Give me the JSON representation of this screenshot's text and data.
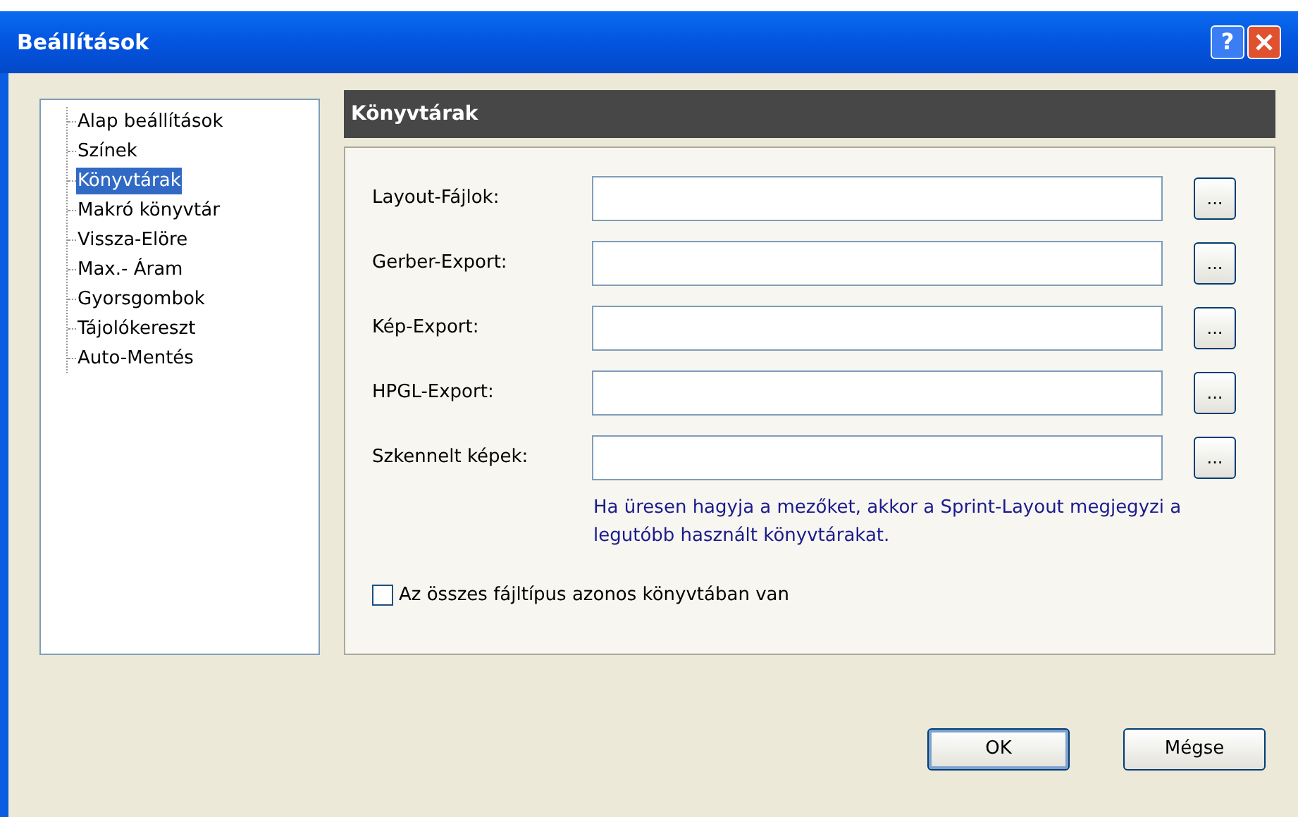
{
  "window": {
    "title": "Beállítások",
    "help_button": "?"
  },
  "sidebar": {
    "items": [
      {
        "label": "Alap beállítások",
        "selected": false
      },
      {
        "label": "Színek",
        "selected": false
      },
      {
        "label": "Könyvtárak",
        "selected": true
      },
      {
        "label": "Makró könyvtár",
        "selected": false
      },
      {
        "label": "Vissza-Elöre",
        "selected": false
      },
      {
        "label": "Max.- Áram",
        "selected": false
      },
      {
        "label": "Gyorsgombok",
        "selected": false
      },
      {
        "label": "Tájolókereszt",
        "selected": false
      },
      {
        "label": "Auto-Mentés",
        "selected": false
      }
    ]
  },
  "panel": {
    "title": "Könyvtárak",
    "fields": [
      {
        "label": "Layout-Fájlok:",
        "browse": "..."
      },
      {
        "label": "Gerber-Export:",
        "browse": "..."
      },
      {
        "label": "Kép-Export:",
        "browse": "..."
      },
      {
        "label": "HPGL-Export:",
        "browse": "..."
      },
      {
        "label": "Szkennelt képek:",
        "browse": "..."
      }
    ],
    "note": "Ha üresen hagyja a mezőket, akkor a Sprint-Layout megjegyzi a legutóbb használt könyvtárakat.",
    "checkbox": {
      "label": "Az összes fájltípus azonos könyvtában van",
      "checked": false
    }
  },
  "buttons": [
    {
      "label": "OK",
      "default": true
    },
    {
      "label": "Mégse",
      "default": false
    }
  ]
}
